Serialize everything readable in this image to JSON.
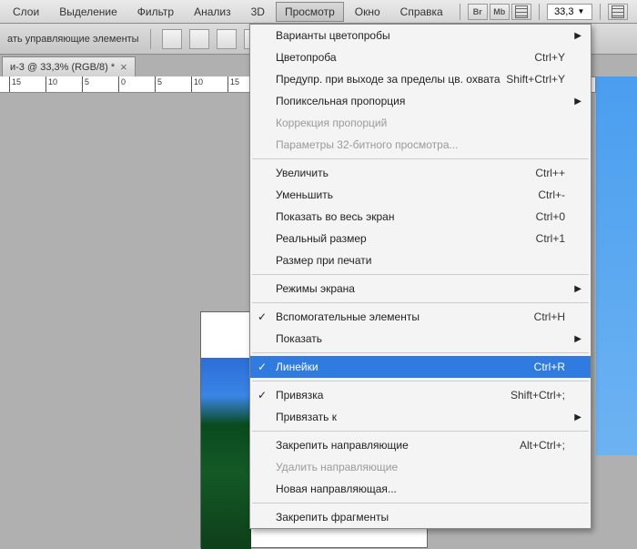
{
  "menubar": {
    "items": [
      "Слои",
      "Выделение",
      "Фильтр",
      "Анализ",
      "3D",
      "Просмотр",
      "Окно",
      "Справка"
    ],
    "open_index": 5,
    "br": "Br",
    "mb": "Mb",
    "zoom": "33,3"
  },
  "toolbar": {
    "label": "ать управляющие элементы"
  },
  "tab": {
    "title": "и-3 @ 33,3% (RGB/8) *"
  },
  "ruler": {
    "ticks": [
      "15",
      "10",
      "5",
      "0",
      "5",
      "10",
      "15"
    ]
  },
  "dropdown": [
    {
      "type": "item",
      "label": "Варианты цветопробы",
      "arrow": true
    },
    {
      "type": "item",
      "label": "Цветопроба",
      "shortcut": "Ctrl+Y"
    },
    {
      "type": "item",
      "label": "Предупр. при выходе за пределы цв. охвата",
      "shortcut": "Shift+Ctrl+Y"
    },
    {
      "type": "item",
      "label": "Попиксельная пропорция",
      "arrow": true
    },
    {
      "type": "item",
      "label": "Коррекция пропорций",
      "disabled": true
    },
    {
      "type": "item",
      "label": "Параметры 32-битного просмотра...",
      "disabled": true
    },
    {
      "type": "sep"
    },
    {
      "type": "item",
      "label": "Увеличить",
      "shortcut": "Ctrl++"
    },
    {
      "type": "item",
      "label": "Уменьшить",
      "shortcut": "Ctrl+-"
    },
    {
      "type": "item",
      "label": "Показать во весь экран",
      "shortcut": "Ctrl+0"
    },
    {
      "type": "item",
      "label": "Реальный размер",
      "shortcut": "Ctrl+1"
    },
    {
      "type": "item",
      "label": "Размер при печати"
    },
    {
      "type": "sep"
    },
    {
      "type": "item",
      "label": "Режимы экрана",
      "arrow": true
    },
    {
      "type": "sep"
    },
    {
      "type": "item",
      "label": "Вспомогательные элементы",
      "check": true,
      "shortcut": "Ctrl+H"
    },
    {
      "type": "item",
      "label": "Показать",
      "arrow": true
    },
    {
      "type": "sep"
    },
    {
      "type": "item",
      "label": "Линейки",
      "check": true,
      "shortcut": "Ctrl+R",
      "highlight": true
    },
    {
      "type": "sep"
    },
    {
      "type": "item",
      "label": "Привязка",
      "check": true,
      "shortcut": "Shift+Ctrl+;"
    },
    {
      "type": "item",
      "label": "Привязать к",
      "arrow": true
    },
    {
      "type": "sep"
    },
    {
      "type": "item",
      "label": "Закрепить направляющие",
      "shortcut": "Alt+Ctrl+;"
    },
    {
      "type": "item",
      "label": "Удалить направляющие",
      "disabled": true
    },
    {
      "type": "item",
      "label": "Новая направляющая..."
    },
    {
      "type": "sep"
    },
    {
      "type": "item",
      "label": "Закрепить фрагменты"
    }
  ]
}
